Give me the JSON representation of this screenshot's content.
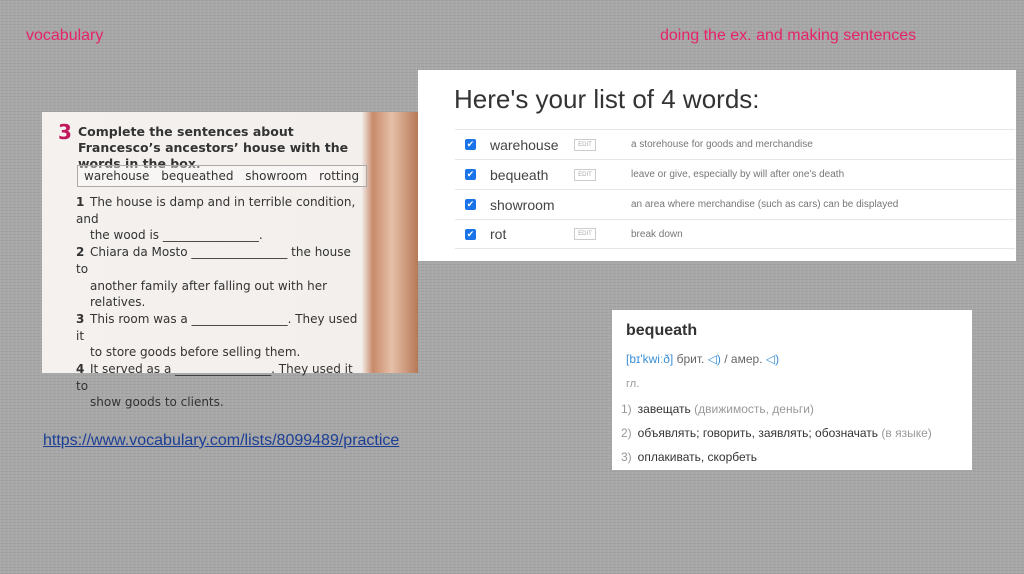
{
  "titles": {
    "left": "vocabulary",
    "right": "doing the ex. and making sentences"
  },
  "exercise": {
    "number": "3",
    "heading": "Complete the sentences about Francesco’s ancestors’ house with the words in the box.",
    "box_words": "warehouse bequeathed showroom rotting",
    "items": [
      {
        "n": "1",
        "line1": "The house is damp and in terrible condition, and",
        "line2": "the wood is ________________."
      },
      {
        "n": "2",
        "line1": "Chiara da Mosto ________________ the house to",
        "line2": "another family after falling out with her relatives."
      },
      {
        "n": "3",
        "line1": "This room was a ________________. They used it",
        "line2": "to store goods before selling them."
      },
      {
        "n": "4",
        "line1": "It served as a ________________. They used it to",
        "line2": "show goods to clients."
      }
    ]
  },
  "word_list": {
    "title": "Here's your list of 4 words:",
    "edit_label": "EDIT",
    "words": [
      {
        "word": "warehouse",
        "definition": "a storehouse for goods and merchandise",
        "editable": true
      },
      {
        "word": "bequeath",
        "definition": "leave or give, especially by will after one's death",
        "editable": true
      },
      {
        "word": "showroom",
        "definition": "an area where merchandise (such as cars) can be displayed",
        "editable": false
      },
      {
        "word": "rot",
        "definition": "break down",
        "editable": true
      }
    ]
  },
  "dictionary": {
    "headword": "bequeath",
    "ipa": "[bɪ'kwiːð]",
    "brit": "брит.",
    "amer": "/ амер.",
    "pos": "гл.",
    "meanings": [
      {
        "n": "1)",
        "text": "завещать",
        "gloss": "(движимость, деньги)"
      },
      {
        "n": "2)",
        "text": "объявлять; говорить, заявлять; обозначать",
        "gloss": "(в языке)"
      },
      {
        "n": "3)",
        "text": "оплакивать, скорбеть",
        "gloss": ""
      }
    ]
  },
  "link": "https://www.vocabulary.com/lists/8099489/practice"
}
